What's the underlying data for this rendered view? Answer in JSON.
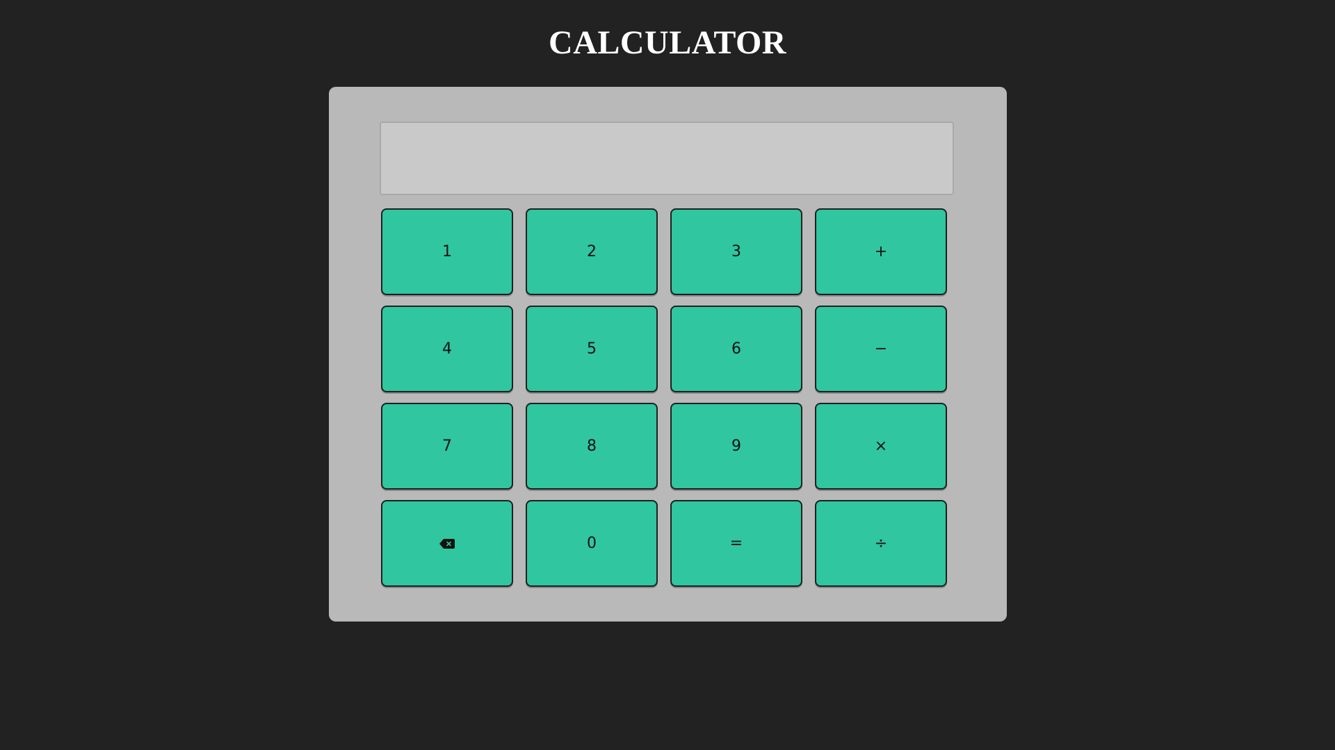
{
  "page": {
    "title": "CALCULATOR"
  },
  "display": {
    "value": "",
    "placeholder": ""
  },
  "keypad": {
    "keys": [
      {
        "label": "1",
        "name": "key-1"
      },
      {
        "label": "2",
        "name": "key-2"
      },
      {
        "label": "3",
        "name": "key-3"
      },
      {
        "label": "+",
        "name": "key-plus"
      },
      {
        "label": "4",
        "name": "key-4"
      },
      {
        "label": "5",
        "name": "key-5"
      },
      {
        "label": "6",
        "name": "key-6"
      },
      {
        "label": "−",
        "name": "key-minus"
      },
      {
        "label": "7",
        "name": "key-7"
      },
      {
        "label": "8",
        "name": "key-8"
      },
      {
        "label": "9",
        "name": "key-9"
      },
      {
        "label": "×",
        "name": "key-multiply"
      },
      {
        "label": "",
        "name": "backspace-button",
        "icon": "backspace-icon"
      },
      {
        "label": "0",
        "name": "key-0"
      },
      {
        "label": "=",
        "name": "key-equals"
      },
      {
        "label": "÷",
        "name": "key-divide"
      }
    ]
  },
  "colors": {
    "background": "#222222",
    "panel": "#b9b9b9",
    "display": "#c9c9c9",
    "key": "#2fc6a0",
    "title": "#ffffff"
  }
}
